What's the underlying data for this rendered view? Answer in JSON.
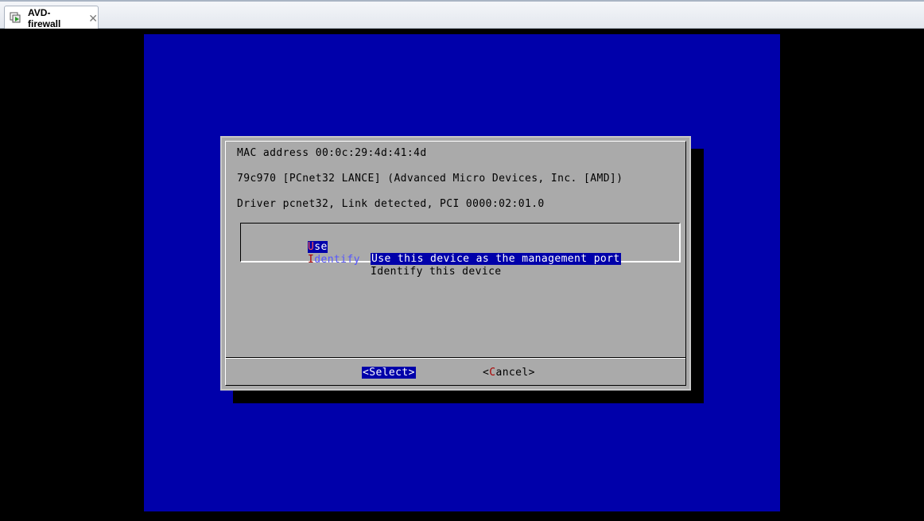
{
  "window": {
    "tab_title": "AVD-firewall",
    "tab_close": "✕"
  },
  "dialog": {
    "lines": [
      "MAC address 00:0c:29:4d:41:4d",
      "79c970 [PCnet32 LANCE] (Advanced Micro Devices, Inc. [AMD])",
      "Driver pcnet32, Link detected, PCI 0000:02:01.0"
    ],
    "menu": [
      {
        "hotkey": "U",
        "tag_rest": "se",
        "description": "Use this device as the management port",
        "selected": true
      },
      {
        "hotkey": "I",
        "tag_rest": "dentify",
        "description": "Identify this device",
        "selected": false
      }
    ],
    "buttons": {
      "select_label": "<Select>",
      "cancel_open": "<",
      "cancel_hotkey": "C",
      "cancel_rest": "ancel>"
    }
  },
  "colors": {
    "screen_bg": "#0000aa",
    "dialog_bg": "#aaaaaa",
    "highlight_bg": "#0000aa",
    "hotkey": "#aa0000",
    "tag_text": "#5555ff"
  }
}
